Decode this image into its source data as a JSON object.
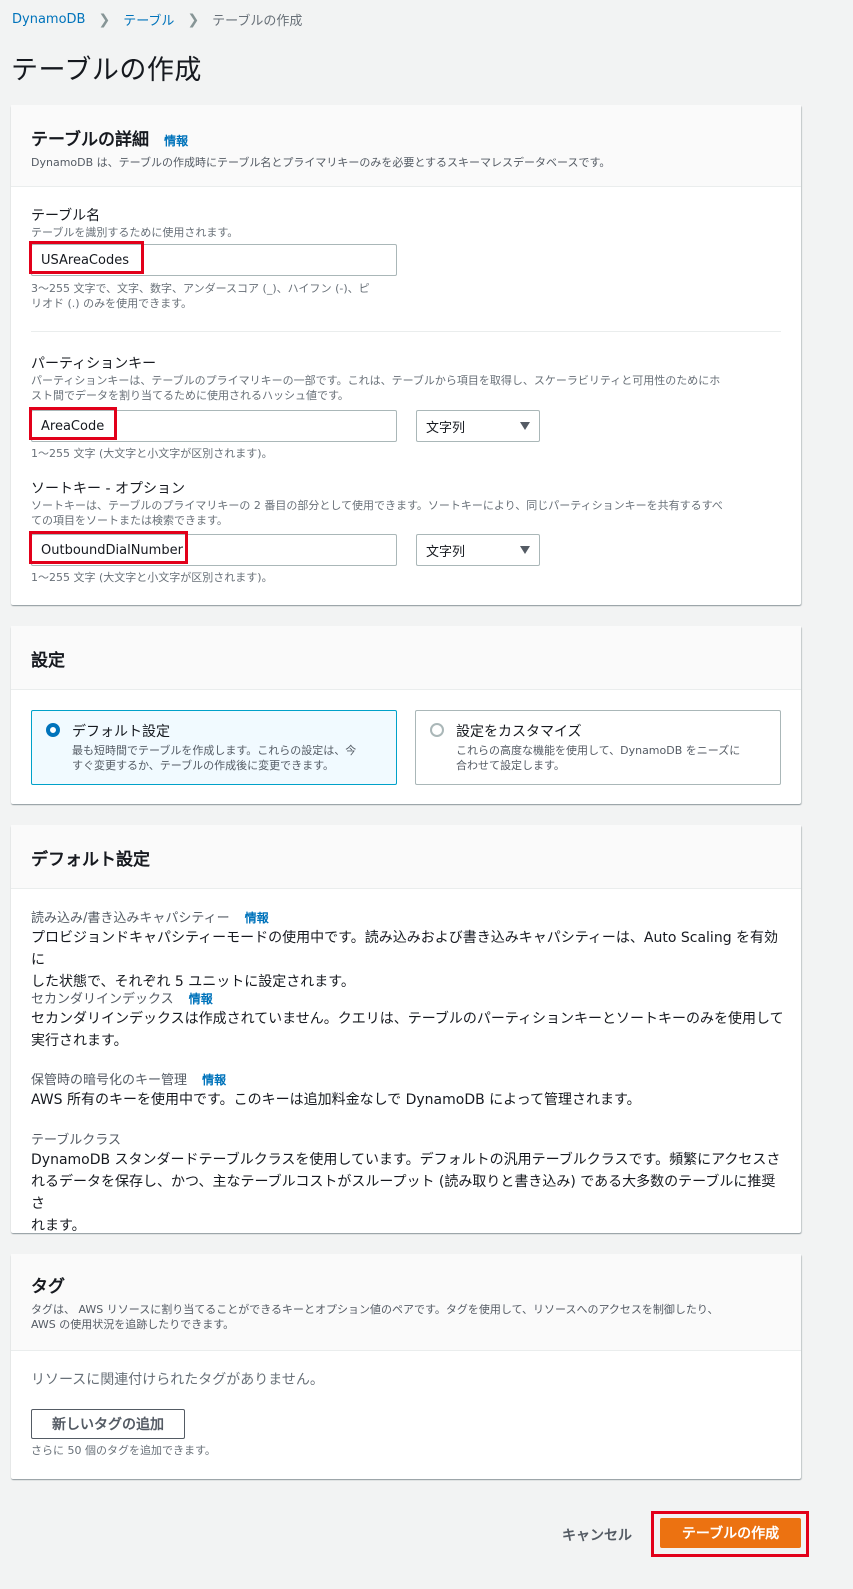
{
  "breadcrumb": {
    "items": [
      "DynamoDB",
      "テーブル",
      "テーブルの作成"
    ]
  },
  "page_title": "テーブルの作成",
  "table_details": {
    "title": "テーブルの詳細",
    "info": "情報",
    "description": "DynamoDB は、テーブルの作成時にテーブル名とプライマリキーのみを必要とするスキーマレスデータベースです。",
    "table_name": {
      "label": "テーブル名",
      "description": "テーブルを識別するために使用されます。",
      "value": "USAreaCodes",
      "hint_line1": "3〜255 文字で、文字、数字、アンダースコア (_)、ハイフン (-)、ピ",
      "hint_line2": "リオド (.) のみを使用できます。"
    },
    "partition_key": {
      "label": "パーティションキー",
      "description_line1": "パーティションキーは、テーブルのプライマリキーの一部です。これは、テーブルから項目を取得し、スケーラビリティと可用性のためにホ",
      "description_line2": "スト間でデータを割り当てるために使用されるハッシュ値です。",
      "value": "AreaCode",
      "type": "文字列",
      "hint": "1〜255 文字 (大文字と小文字が区別されます)。"
    },
    "sort_key": {
      "label": "ソートキー - オプション",
      "description_line1": "ソートキーは、テーブルのプライマリキーの 2 番目の部分として使用できます。ソートキーにより、同じパーティションキーを共有するすべ",
      "description_line2": "ての項目をソートまたは検索できます。",
      "value": "OutboundDialNumber",
      "type": "文字列",
      "hint": "1〜255 文字 (大文字と小文字が区別されます)。"
    }
  },
  "settings": {
    "title": "設定",
    "options": [
      {
        "label": "デフォルト設定",
        "desc_line1": "最も短時間でテーブルを作成します。これらの設定は、今",
        "desc_line2": "すぐ変更するか、テーブルの作成後に変更できます。",
        "selected": true
      },
      {
        "label": "設定をカスタマイズ",
        "desc_line1": "これらの高度な機能を使用して、DynamoDB をニーズに",
        "desc_line2": "合わせて設定します。",
        "selected": false
      }
    ]
  },
  "default_settings": {
    "title": "デフォルト設定",
    "items": [
      {
        "label": "読み込み/書き込みキャパシティー",
        "info": "情報",
        "line1": "プロビジョンドキャパシティーモードの使用中です。読み込みおよび書き込みキャパシティーは、Auto Scaling を有効に",
        "line2": "した状態で、それぞれ 5 ユニットに設定されます。"
      },
      {
        "label": "セカンダリインデックス",
        "info": "情報",
        "line1": "セカンダリインデックスは作成されていません。クエリは、テーブルのパーティションキーとソートキーのみを使用して",
        "line2": "実行されます。"
      },
      {
        "label": "保管時の暗号化のキー管理",
        "info": "情報",
        "line1": "AWS 所有のキーを使用中です。このキーは追加料金なしで DynamoDB によって管理されます。",
        "line2": ""
      },
      {
        "label": "テーブルクラス",
        "info": "",
        "line1": "DynamoDB スタンダードテーブルクラスを使用しています。デフォルトの汎用テーブルクラスです。頻繁にアクセスさ",
        "line2": "れるデータを保存し、かつ、主なテーブルコストがスループット (読み取りと書き込み) である大多数のテーブルに推奨さ",
        "line3": "れます。"
      }
    ]
  },
  "tags": {
    "title": "タグ",
    "description_line1": "タグは、 AWS リソースに割り当てることができるキーとオプション値のペアです。タグを使用して、リソースへのアクセスを制御したり、",
    "description_line2": "AWS の使用状況を追跡したりできます。",
    "empty_text": "リソースに関連付けられたタグがありません。",
    "add_button": "新しいタグの追加",
    "remaining_hint": "さらに 50 個のタグを追加できます。"
  },
  "footer": {
    "cancel_label": "キャンセル",
    "create_label": "テーブルの作成"
  },
  "colors": {
    "accent": "#0073bb",
    "primary_button": "#ec7211",
    "highlight": "#e2001a"
  }
}
